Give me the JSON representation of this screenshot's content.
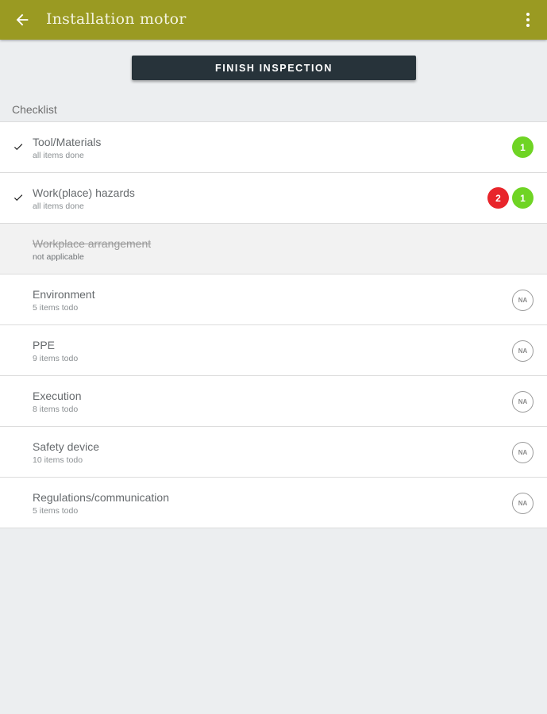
{
  "appbar": {
    "title": "Installation motor",
    "back_icon": "arrow-left-icon",
    "menu_icon": "more-vert-icon",
    "color": "#9a9a22"
  },
  "finish_button": {
    "label": "FINISH INSPECTION",
    "color": "#27333a"
  },
  "section": {
    "label": "Checklist"
  },
  "checklist": [
    {
      "title": "Tool/Materials",
      "subtitle": "all items done",
      "checked": true,
      "disabled": false,
      "badges": [
        {
          "value": "1",
          "color": "green"
        }
      ]
    },
    {
      "title": "Work(place) hazards",
      "subtitle": "all items done",
      "checked": true,
      "disabled": false,
      "badges": [
        {
          "value": "2",
          "color": "red"
        },
        {
          "value": "1",
          "color": "green"
        }
      ]
    },
    {
      "title": "Workplace arrangement",
      "subtitle": "not applicable",
      "checked": false,
      "disabled": true,
      "badges": []
    },
    {
      "title": "Environment",
      "subtitle": "5 items todo",
      "checked": false,
      "disabled": false,
      "na": "NA"
    },
    {
      "title": "PPE",
      "subtitle": "9 items todo",
      "checked": false,
      "disabled": false,
      "na": "NA"
    },
    {
      "title": "Execution",
      "subtitle": "8 items todo",
      "checked": false,
      "disabled": false,
      "na": "NA"
    },
    {
      "title": "Safety device",
      "subtitle": "10 items todo",
      "checked": false,
      "disabled": false,
      "na": "NA"
    },
    {
      "title": "Regulations/communication",
      "subtitle": "5 items todo",
      "checked": false,
      "disabled": false,
      "na": "NA"
    }
  ],
  "colors": {
    "badge_red": "#e8252b",
    "badge_green": "#6fd424"
  }
}
